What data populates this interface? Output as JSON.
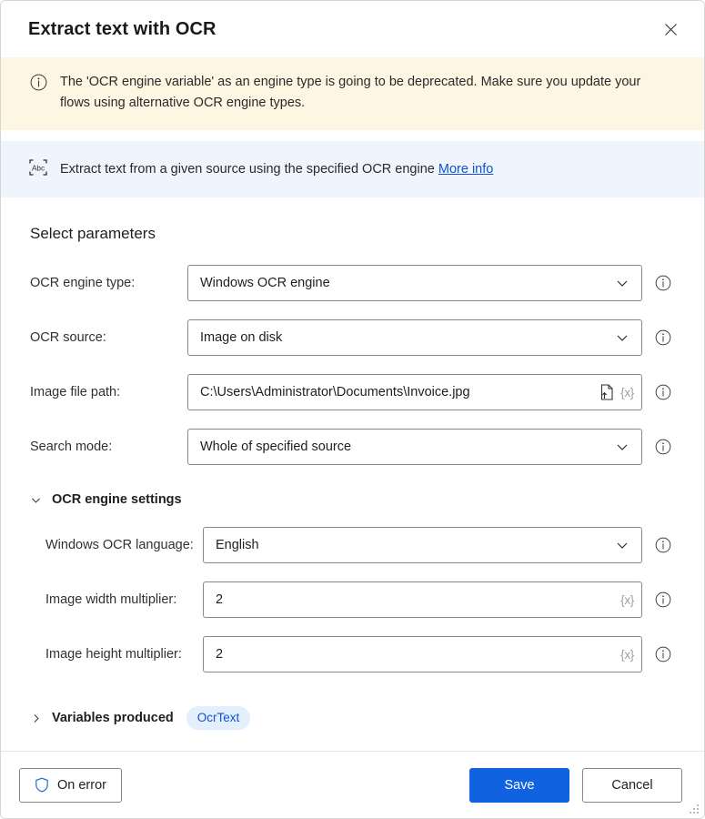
{
  "window": {
    "title": "Extract text with OCR",
    "close_label": "✕"
  },
  "warning_banner": {
    "icon": "info-circle-icon",
    "text": "The 'OCR engine variable' as an engine type is going to be deprecated.  Make sure you update your flows using alternative OCR engine types."
  },
  "description_banner": {
    "icon": "abc-ocr-icon",
    "text": "Extract text from a given source using the specified OCR engine",
    "link_label": "More info"
  },
  "main": {
    "section_title": "Select parameters",
    "parameters": [
      {
        "label": "OCR engine type:",
        "value": "Windows OCR engine",
        "control": "dropdown"
      },
      {
        "label": "OCR source:",
        "value": "Image on disk",
        "control": "dropdown"
      },
      {
        "label": "Image file path:",
        "value": "C:\\Users\\Administrator\\Documents\\Invoice.jpg",
        "control": "text-with-file-picker",
        "file_icon": "file-upload-icon",
        "variable_token": "{x}"
      },
      {
        "label": "Search mode:",
        "value": "Whole of specified source",
        "control": "dropdown"
      }
    ],
    "engine_settings": {
      "title": "OCR engine settings",
      "expanded": true,
      "chevron": "chevron-down-icon",
      "fields": [
        {
          "label": "Windows OCR language:",
          "value": "English",
          "control": "dropdown"
        },
        {
          "label": "Image width multiplier:",
          "value": "2",
          "control": "text",
          "variable_token": "{x}"
        },
        {
          "label": "Image height multiplier:",
          "value": "2",
          "control": "text",
          "variable_token": "{x}"
        }
      ]
    },
    "variables_produced": {
      "title": "Variables produced",
      "expanded": false,
      "chevron": "chevron-right-icon",
      "variables": [
        "OcrText"
      ]
    }
  },
  "footer": {
    "on_error_label": "On error",
    "on_error_icon": "shield-icon",
    "save_label": "Save",
    "cancel_label": "Cancel"
  },
  "colors": {
    "warning_background": "#fdf6e3",
    "description_background": "#eff4fd",
    "primary_button": "#1062e0",
    "link": "#1152d4",
    "variable_pill_bg": "#e3effd",
    "variable_pill_text": "#1152d4",
    "shield_icon": "#1f6fe0"
  }
}
